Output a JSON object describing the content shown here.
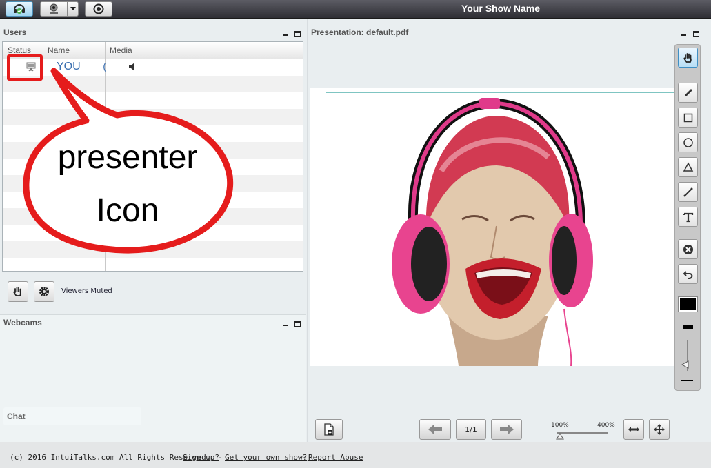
{
  "topbar": {
    "show_title": "Your Show Name",
    "buttons": [
      "headset-status-icon",
      "webcam-icon",
      "dropdown-arrow-icon",
      "record-icon"
    ]
  },
  "users_panel": {
    "title": "Users",
    "columns": [
      "Status",
      "Name",
      "Media"
    ],
    "rows": [
      {
        "status_icon": "presenter-icon",
        "name": "YOU",
        "media_icon": "speaker-icon"
      }
    ],
    "viewers_muted_label": "Viewers Muted"
  },
  "callout": {
    "line1": "presenter",
    "line2": "Icon"
  },
  "webcams_panel": {
    "title": "Webcams"
  },
  "chat_tab": {
    "label": "Chat"
  },
  "presentation": {
    "title": "Presentation: default.pdf",
    "page_indicator": "1/1",
    "zoom_min": "100%",
    "zoom_max": "400%"
  },
  "whiteboard_tools": [
    "hand-icon",
    "pencil-icon",
    "rectangle-icon",
    "ellipse-icon",
    "triangle-icon",
    "line-icon",
    "text-icon",
    "clear-icon",
    "undo-icon",
    "color-swatch",
    "thickness-icon"
  ],
  "footer": {
    "copyright": "(c) 2016 IntuiTalks.com All Rights Reserved.",
    "sign_up": "Sign up?",
    "sep1": "-",
    "get_show": "Get your own show?",
    "sep2": "-",
    "report": "Report Abuse"
  },
  "colors": {
    "accent_blue": "#3a6fb0",
    "callout_red": "#e51c1c",
    "topbar": "#3b3b42"
  }
}
